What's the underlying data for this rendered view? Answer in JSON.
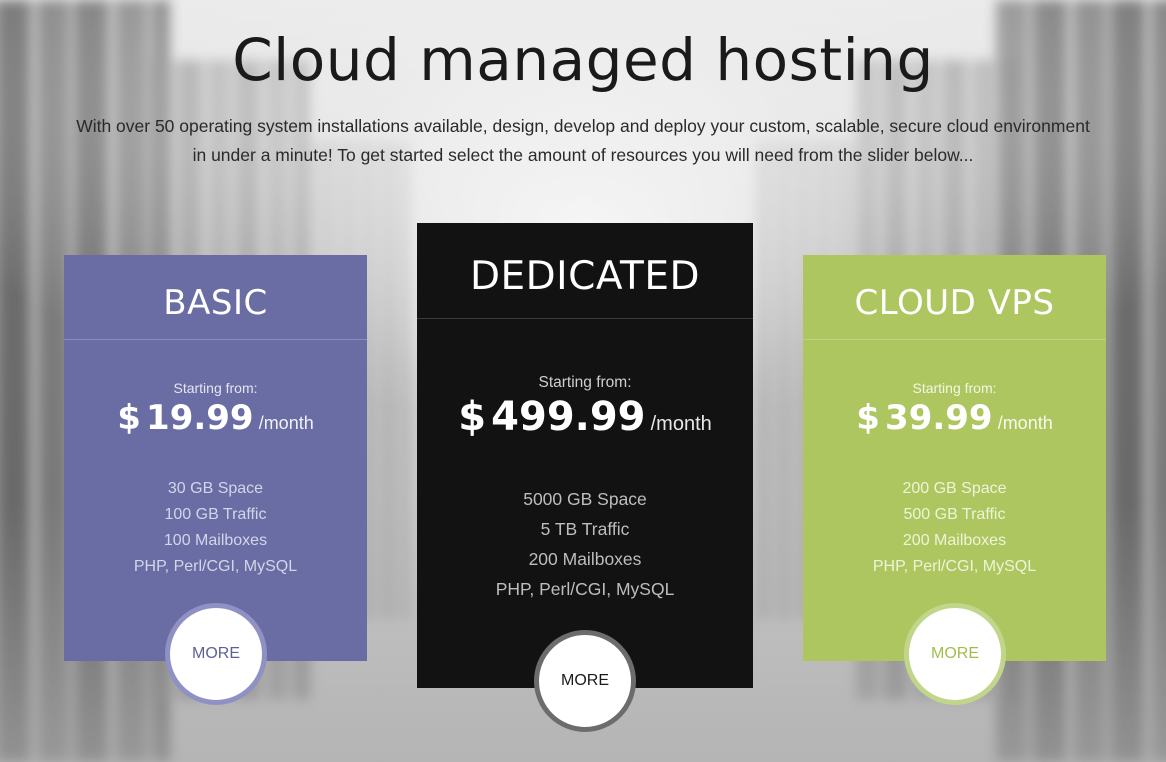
{
  "hero": {
    "title": "Cloud managed hosting",
    "subtitle_line1": "With over 50 operating system installations available, design, develop and deploy your custom, scalable, secure cloud environment",
    "subtitle_line2": "in under a minute! To get started select the amount of resources you will need from the slider below..."
  },
  "plans": {
    "basic": {
      "name": "BASIC",
      "starting_label": "Starting from:",
      "currency": "$",
      "price": "19.99",
      "period": "/month",
      "features": [
        "30 GB Space",
        "100 GB Traffic",
        "100 Mailboxes",
        "PHP, Perl/CGI, MySQL"
      ],
      "button_label": "MORE",
      "color": "#6a6da3"
    },
    "dedicated": {
      "name": "DEDICATED",
      "starting_label": "Starting from:",
      "currency": "$",
      "price": "499.99",
      "period": "/month",
      "features": [
        "5000 GB Space",
        "5 TB Traffic",
        "200 Mailboxes",
        "PHP, Perl/CGI, MySQL"
      ],
      "button_label": "MORE",
      "color": "#121212"
    },
    "cloud": {
      "name": "CLOUD VPS",
      "starting_label": "Starting from:",
      "currency": "$",
      "price": "39.99",
      "period": "/month",
      "features": [
        "200 GB Space",
        "500 GB Traffic",
        "200 Mailboxes",
        "PHP, Perl/CGI, MySQL"
      ],
      "button_label": "MORE",
      "color": "#aec660"
    }
  }
}
